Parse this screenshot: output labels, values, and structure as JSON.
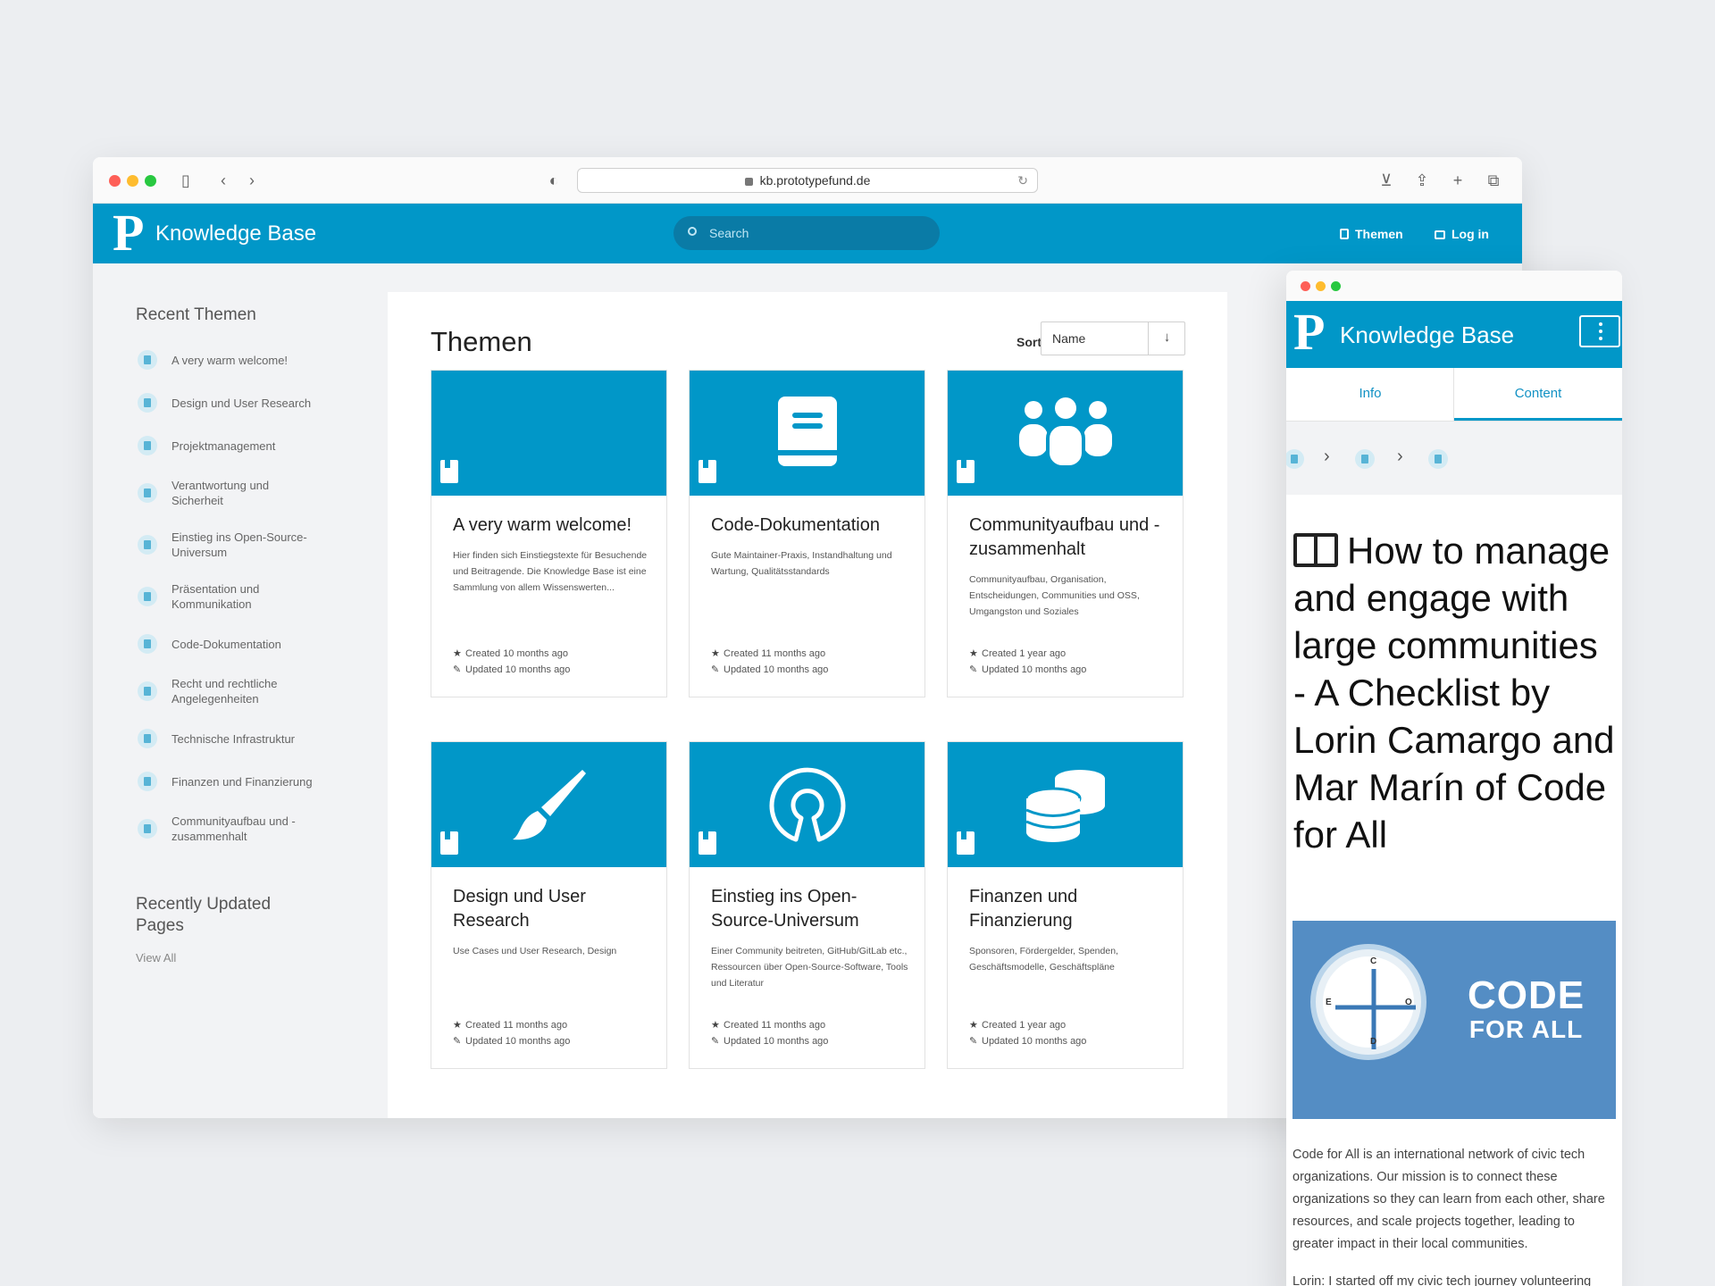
{
  "browser": {
    "url": "kb.prototypefund.de"
  },
  "header": {
    "logo_letter": "P",
    "brand": "Knowledge Base",
    "search_placeholder": "Search",
    "nav_themen": "Themen",
    "nav_login": "Log in"
  },
  "sidebar": {
    "recent_heading": "Recent Themen",
    "items": [
      "A very warm welcome!",
      "Design und User Research",
      "Projektmanagement",
      "Verantwortung und Sicherheit",
      "Einstieg ins Open-Source-Universum",
      "Präsentation und Kommunikation",
      "Code-Dokumentation",
      "Recht und rechtliche Angelegenheiten",
      "Technische Infrastruktur",
      "Finanzen und Finanzierung",
      "Communityaufbau und -zusammenhalt"
    ],
    "updated_heading": "Recently Updated Pages",
    "view_all": "View All"
  },
  "main": {
    "title": "Themen",
    "sort_label": "Sort",
    "sort_value": "Name",
    "sort_dir": "↓",
    "cards": [
      {
        "icon": "none",
        "title": "A very warm welcome!",
        "desc": "Hier finden sich Einstiegstexte für Besuchende und Beitragende. Die Knowledge Base ist eine Sammlung von allem Wissenswerten...",
        "created": "Created 10 months ago",
        "updated": "Updated 10 months ago"
      },
      {
        "icon": "book-icon",
        "title": "Code-Dokumentation",
        "desc": "Gute Maintainer-Praxis, Instandhaltung und Wartung, Qualitätsstandards",
        "created": "Created 11 months ago",
        "updated": "Updated 10 months ago"
      },
      {
        "icon": "users-icon",
        "title": "Communityaufbau und -zusammenhalt",
        "desc": "Communityaufbau, Organisation, Entscheidungen, Communities und OSS, Umgangston und Soziales",
        "created": "Created 1 year ago",
        "updated": "Updated 10 months ago"
      },
      {
        "icon": "brush-icon",
        "title": "Design und User Research",
        "desc": "Use Cases und User Research, Design",
        "created": "Created 11 months ago",
        "updated": "Updated 10 months ago"
      },
      {
        "icon": "open-source-icon",
        "title": "Einstieg ins Open-Source-Universum",
        "desc": "Einer Community beitreten, GitHub/GitLab etc., Ressourcen über Open-Source-Software, Tools und Literatur",
        "created": "Created 11 months ago",
        "updated": "Updated 10 months ago"
      },
      {
        "icon": "coins-icon",
        "title": "Finanzen und Finanzierung",
        "desc": "Sponsoren, Fördergelder, Spenden, Geschäftsmodelle, Geschäftspläne",
        "created": "Created 1 year ago",
        "updated": "Updated 10 months ago"
      }
    ]
  },
  "mobile": {
    "brand": "Knowledge Base",
    "logo_letter": "P",
    "tab_info": "Info",
    "tab_content": "Content",
    "page_title": "How to manage and engage with large communities - A Checklist by Lorin Camargo and Mar Marín of Code for All",
    "image_text_line1": "CODE",
    "image_text_line2": "FOR ALL",
    "compass_n": "C",
    "compass_e": "O",
    "compass_s": "D",
    "compass_w": "E",
    "paragraph1": "Code for All is an international network of civic tech organizations. Our mission is to connect these organizations so they can learn from each other, share resources, and scale projects together, leading to greater impact in their local communities.",
    "paragraph2": "Lorin: I started off my civic tech journey volunteering"
  },
  "colors": {
    "brand": "#0197c8",
    "background": "#f2f3f5"
  }
}
